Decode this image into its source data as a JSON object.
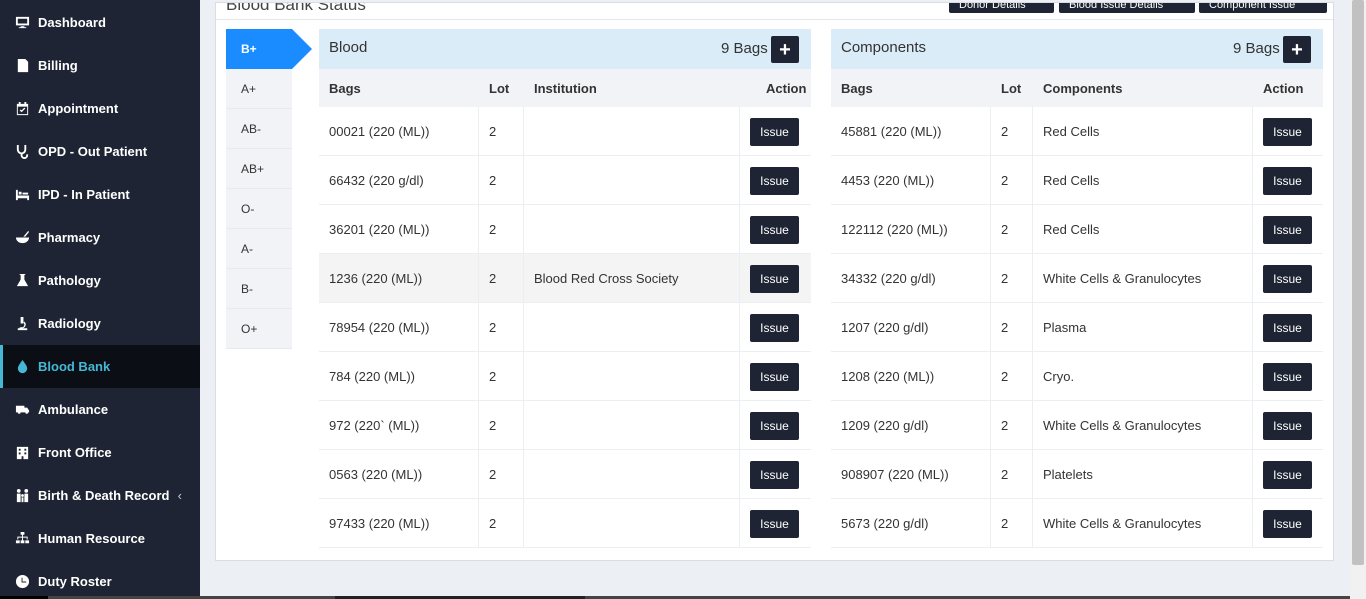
{
  "sidebar": {
    "items": [
      {
        "label": "Dashboard",
        "icon": "monitor-icon"
      },
      {
        "label": "Billing",
        "icon": "receipt-icon"
      },
      {
        "label": "Appointment",
        "icon": "calendar-icon"
      },
      {
        "label": "OPD - Out Patient",
        "icon": "stethoscope-icon"
      },
      {
        "label": "IPD - In Patient",
        "icon": "bed-icon"
      },
      {
        "label": "Pharmacy",
        "icon": "mortar-pestle-icon"
      },
      {
        "label": "Pathology",
        "icon": "flask-icon"
      },
      {
        "label": "Radiology",
        "icon": "microscope-icon"
      },
      {
        "label": "Blood Bank",
        "icon": "droplet-icon"
      },
      {
        "label": "Ambulance",
        "icon": "ambulance-icon"
      },
      {
        "label": "Front Office",
        "icon": "building-icon"
      },
      {
        "label": "Birth & Death Record",
        "icon": "family-icon"
      },
      {
        "label": "Human Resource",
        "icon": "sitemap-icon"
      },
      {
        "label": "Duty Roster",
        "icon": "clock-icon"
      }
    ],
    "active_index": 8,
    "accent_color": "#45b8d6"
  },
  "box": {
    "title": "Blood Bank Status",
    "buttons": [
      "Donor Details",
      "Blood Issue Details",
      "Component Issue"
    ]
  },
  "tabs": [
    "B+",
    "A+",
    "AB-",
    "AB+",
    "O-",
    "A-",
    "B-",
    "O+"
  ],
  "blood": {
    "title": "Blood",
    "count": "9 Bags",
    "add_label": "+",
    "headers": [
      "Bags",
      "Lot",
      "Institution",
      "Action"
    ],
    "rows": [
      {
        "bag": "00021 (220 (ML))",
        "lot": "2",
        "institution": "",
        "action": "Issue"
      },
      {
        "bag": "66432 (220 g/dl)",
        "lot": "2",
        "institution": "",
        "action": "Issue"
      },
      {
        "bag": "36201 (220 (ML))",
        "lot": "2",
        "institution": "",
        "action": "Issue"
      },
      {
        "bag": "1236 (220 (ML))",
        "lot": "2",
        "institution": "Blood Red Cross Society",
        "action": "Issue"
      },
      {
        "bag": "78954 (220 (ML))",
        "lot": "2",
        "institution": "",
        "action": "Issue"
      },
      {
        "bag": "784 (220 (ML))",
        "lot": "2",
        "institution": "",
        "action": "Issue"
      },
      {
        "bag": "972 (220` (ML))",
        "lot": "2",
        "institution": "",
        "action": "Issue"
      },
      {
        "bag": "0563 (220 (ML))",
        "lot": "2",
        "institution": "",
        "action": "Issue"
      },
      {
        "bag": "97433 (220 (ML))",
        "lot": "2",
        "institution": "",
        "action": "Issue"
      }
    ]
  },
  "components": {
    "title": "Components",
    "count": "9 Bags",
    "add_label": "+",
    "headers": [
      "Bags",
      "Lot",
      "Components",
      "Action"
    ],
    "rows": [
      {
        "bag": "45881 (220 (ML))",
        "lot": "2",
        "component": "Red Cells",
        "action": "Issue"
      },
      {
        "bag": "4453 (220 (ML))",
        "lot": "2",
        "component": "Red Cells",
        "action": "Issue"
      },
      {
        "bag": "122112 (220 (ML))",
        "lot": "2",
        "component": "Red Cells",
        "action": "Issue"
      },
      {
        "bag": "34332 (220 g/dl)",
        "lot": "2",
        "component": "White Cells & Granulocytes",
        "action": "Issue"
      },
      {
        "bag": "1207 (220 g/dl)",
        "lot": "2",
        "component": "Plasma",
        "action": "Issue"
      },
      {
        "bag": "1208 (220 (ML))",
        "lot": "2",
        "component": "Cryo.",
        "action": "Issue"
      },
      {
        "bag": "1209 (220 g/dl)",
        "lot": "2",
        "component": "White Cells & Granulocytes",
        "action": "Issue"
      },
      {
        "bag": "908907 (220 (ML))",
        "lot": "2",
        "component": "Platelets",
        "action": "Issue"
      },
      {
        "bag": "5673 (220 g/dl)",
        "lot": "2",
        "component": "White Cells & Granulocytes",
        "action": "Issue"
      }
    ]
  },
  "colors": {
    "sidebar_bg": "#1e2433",
    "active_tab": "#1a8cff",
    "panel_header": "#d9ecf7",
    "button_dark": "#1e2433"
  }
}
